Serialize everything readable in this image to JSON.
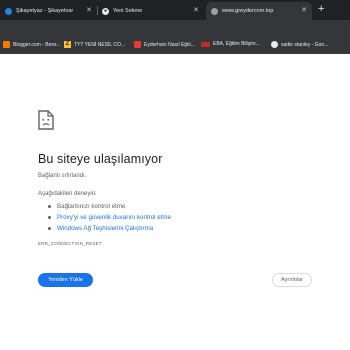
{
  "browser": {
    "tabs": [
      {
        "title": "Şikayetyaz - Şikayetvar",
        "icon": "site-favicon"
      },
      {
        "title": "Yeni Sekme",
        "icon": "chrome-icon"
      },
      {
        "title": "www.greydercom.top",
        "icon": "globe-icon"
      }
    ],
    "new_tab_glyph": "+",
    "close_glyph": "✕"
  },
  "bookmarks": [
    {
      "label": "Blogger.com - Benz...",
      "icon": "blogger-icon",
      "color": "#f57c00"
    },
    {
      "label": "TYT YENİ NESİL CO...",
      "icon": "z-logo-icon",
      "color": "#fbc02d"
    },
    {
      "label": "Eyderhanı Nasıl Eğiti...",
      "icon": "video-icon",
      "color": "#e53935"
    },
    {
      "label": "EBA, Eğitim Bilişim...",
      "icon": "eba-icon",
      "color": "#c62828"
    },
    {
      "label": "sadie stanley - Goo...",
      "icon": "google-icon",
      "color": "#e8eaed"
    }
  ],
  "error_page": {
    "title": "Bu siteye ulaşılamıyor",
    "subtitle": "Bağlantı sıfırlandı.",
    "try_heading": "Aşağıdakileri deneyin:",
    "suggestions": [
      {
        "label": "Bağlantınızı kontrol etme",
        "link": false
      },
      {
        "label": "Proxy'yi ve güvenlik duvarını kontrol etme",
        "link": true
      },
      {
        "label": "Windows Ağ Teşhislerini Çalıştırma",
        "link": true
      }
    ],
    "error_code": "ERR_CONNECTION_RESET",
    "reload_label": "Yeniden Yükle",
    "details_label": "Ayrıntılar"
  },
  "colors": {
    "accent": "#1a73e8",
    "tab_bar": "#202124",
    "toolbar": "#35363a"
  }
}
